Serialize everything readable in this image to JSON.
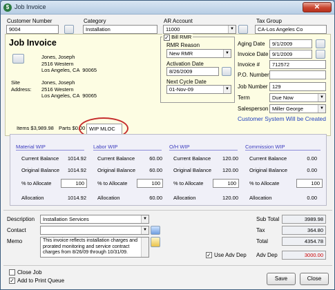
{
  "window": {
    "title": "Job Invoice",
    "close_glyph": "✕"
  },
  "top": {
    "customer_number": {
      "label": "Customer Number",
      "value": "9004"
    },
    "category": {
      "label": "Category",
      "value": "Installation"
    },
    "ar_account": {
      "label": "AR Account",
      "value": "11000"
    },
    "tax_group": {
      "label": "Tax Group",
      "value": "CA-Los Angeles Co"
    }
  },
  "job": {
    "title": "Job Invoice",
    "bill_address": "Jones, Joseph\n2516 Western\nLos Angeles, CA  90065",
    "site_label": "Site\nAddress:",
    "site_address": "Jones, Joseph\n2516 Western\nLos Angeles, CA  90065"
  },
  "rmr": {
    "bill_label": "Bill RMR",
    "reason_label": "RMR Reason",
    "reason_value": "New RMR",
    "activation_label": "Activation Date",
    "activation_value": "8/26/2009",
    "next_cycle_label": "Next Cycle Date",
    "next_cycle_value": "01-Nov-09"
  },
  "details": {
    "aging_date": {
      "label": "Aging Date",
      "value": "9/1/2009"
    },
    "invoice_date": {
      "label": "Invoice Date",
      "value": "9/1/2009"
    },
    "invoice_no": {
      "label": "Invoice #",
      "value": "712572"
    },
    "po_number": {
      "label": "P.O. Number",
      "value": ""
    },
    "job_number": {
      "label": "Job Number",
      "value": "129"
    },
    "term": {
      "label": "Term",
      "value": "Due Now"
    },
    "salesperson": {
      "label": "Salesperson",
      "value": "Miller George"
    },
    "notice": "Customer System Will be Created"
  },
  "tabs": [
    {
      "label": "Items $3,989.98"
    },
    {
      "label": "Parts $0.00"
    },
    {
      "label": "WIP MLOC"
    }
  ],
  "wip": {
    "row_labels": {
      "current": "Current Balance",
      "original": "Original Balance",
      "allocate": "% to Allocate",
      "allocation": "Allocation"
    },
    "columns": [
      {
        "head": "Material WIP",
        "current": "1014.92",
        "original": "1014.92",
        "allocate": "100",
        "allocation": "1014.92"
      },
      {
        "head": "Labor WIP",
        "current": "60.00",
        "original": "60.00",
        "allocate": "100",
        "allocation": "60.00"
      },
      {
        "head": "O/H WIP",
        "current": "120.00",
        "original": "120.00",
        "allocate": "100",
        "allocation": "120.00"
      },
      {
        "head": "Commission WIP",
        "current": "0.00",
        "original": "0.00",
        "allocate": "100",
        "allocation": "0.00"
      }
    ]
  },
  "bottom": {
    "description": {
      "label": "Description",
      "value": "Installation Services"
    },
    "contact": {
      "label": "Contact",
      "value": ""
    },
    "memo": {
      "label": "Memo",
      "value": "This invoice reflects installation charges and prorated monitoring and service contract charges from 8/26/09 through 10/31/09."
    },
    "use_adv_dep": "Use Adv Dep",
    "subtotal": {
      "label": "Sub Total",
      "value": "3989.98"
    },
    "tax": {
      "label": "Tax",
      "value": "364.80"
    },
    "total": {
      "label": "Total",
      "value": "4354.78"
    },
    "adv_dep": {
      "label": "Adv Dep",
      "value": "3000.00"
    }
  },
  "footer": {
    "close_job": "Close Job",
    "add_print_queue": "Add to Print Queue",
    "save": "Save",
    "close": "Close"
  },
  "colors": {
    "accent_text": "#1f3fbf",
    "highlight_ring": "#c62e2e",
    "adv_dep_value": "#cc0000"
  }
}
